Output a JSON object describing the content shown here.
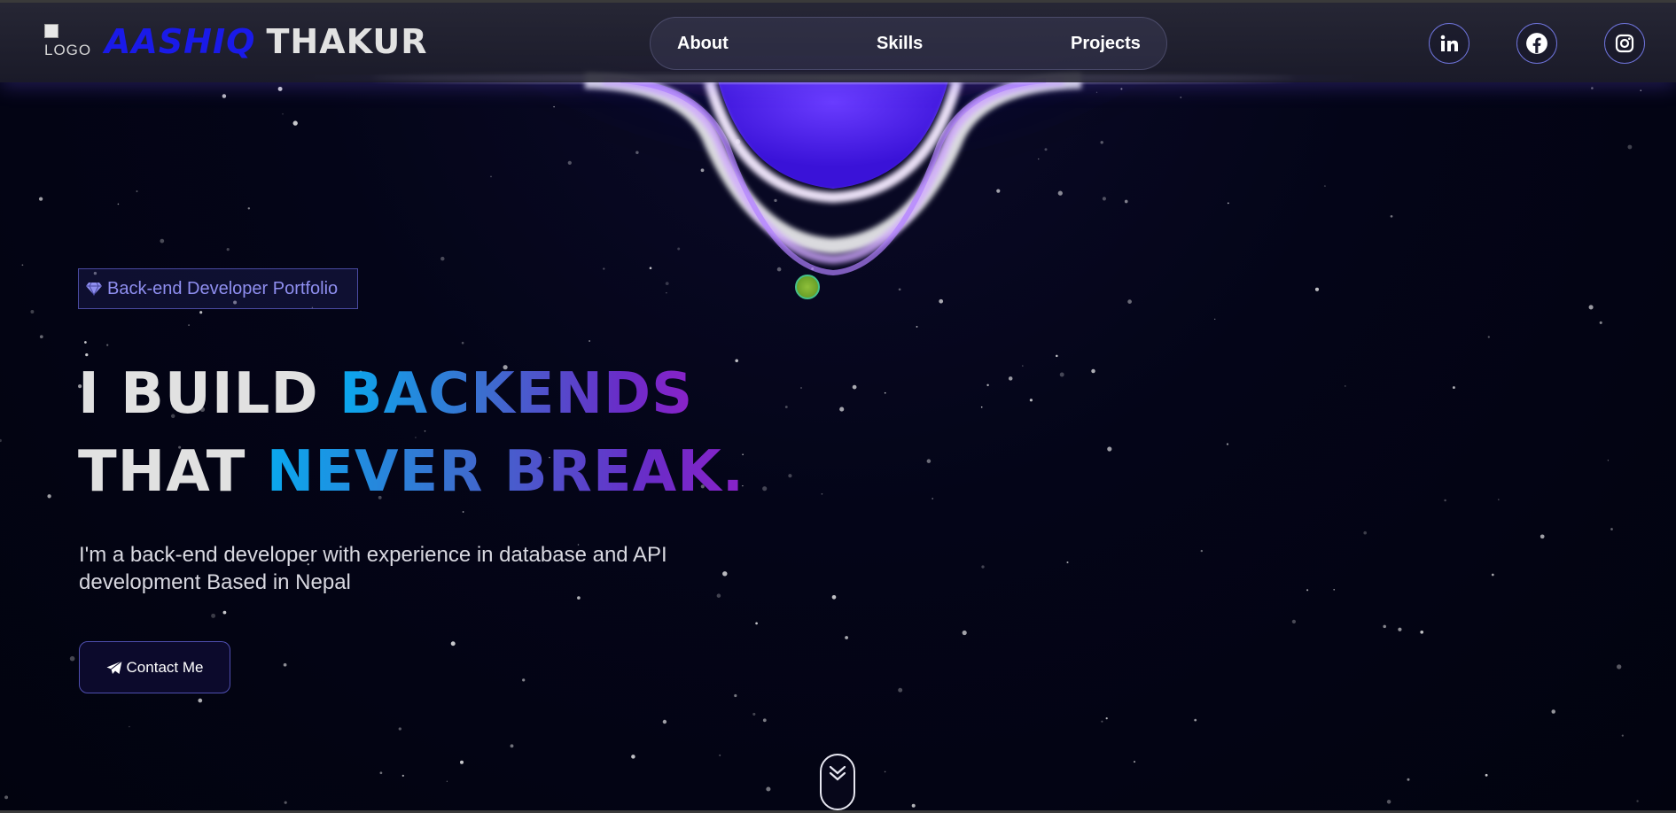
{
  "header": {
    "logo_alt": "LOGO",
    "brand_first": "AASHIQ",
    "brand_last": "THAKUR",
    "nav": [
      {
        "label": "About"
      },
      {
        "label": "Skills"
      },
      {
        "label": "Projects"
      }
    ],
    "social": [
      "linkedin-icon",
      "facebook-icon",
      "instagram-icon"
    ]
  },
  "hero": {
    "badge": "Back-end Developer Portfolio",
    "line1_plain": "I BUILD ",
    "line1_accent": "BACKENDS",
    "line2_plain": "THAT ",
    "line2_accent": "NEVER BREAK.",
    "description": "I'm a back-end developer with experience in database and API development Based in Nepal",
    "contact_label": "Contact Me"
  },
  "colors": {
    "brand_first": "#1a1ae8",
    "accent_start": "#0aa8ee",
    "accent_end": "#8a22c8",
    "badge_text": "#8f8ff0",
    "background": "#030414"
  }
}
